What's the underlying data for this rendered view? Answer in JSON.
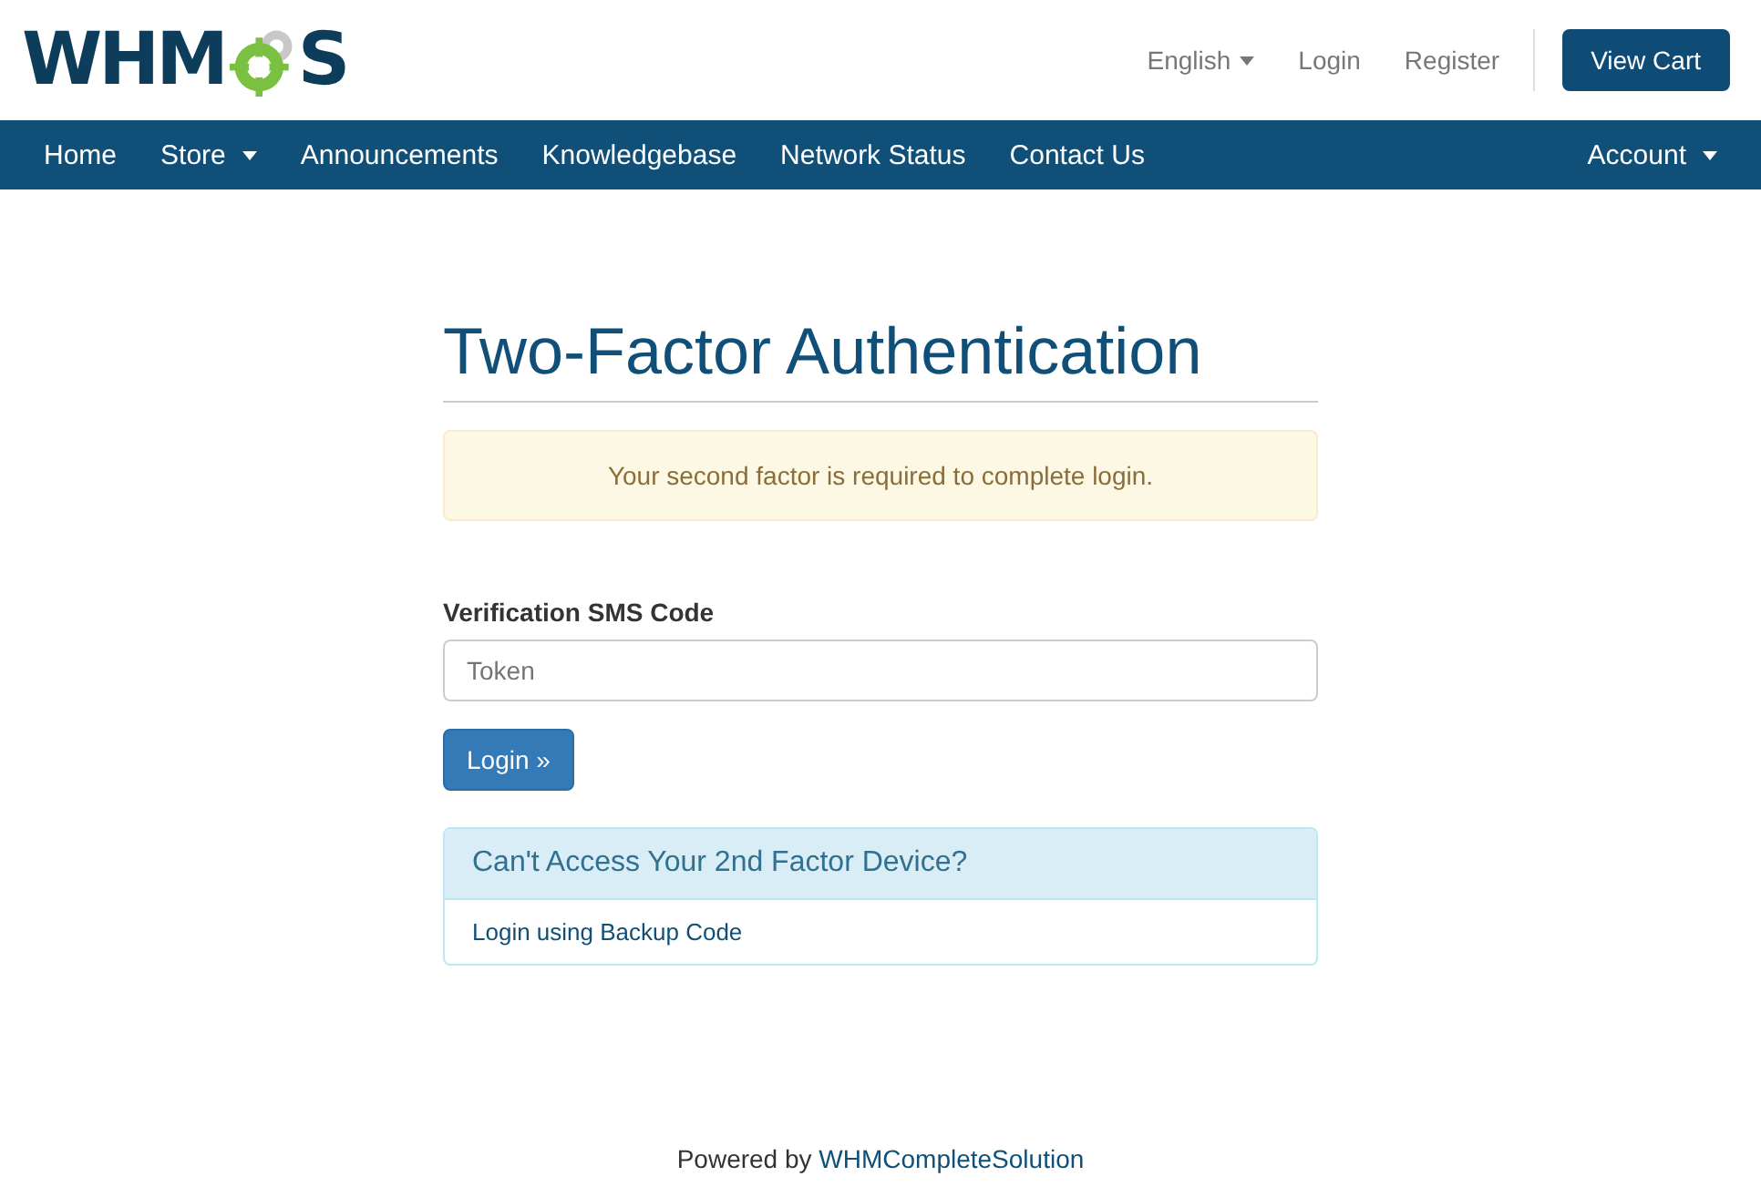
{
  "logo": {
    "text_before": "WHM",
    "text_after": "S"
  },
  "top_links": [
    {
      "label": "English",
      "dropdown": true
    },
    {
      "label": "Login",
      "dropdown": false
    },
    {
      "label": "Register",
      "dropdown": false
    }
  ],
  "cart_button": "View Cart",
  "nav": {
    "left": [
      {
        "label": "Home",
        "dropdown": false
      },
      {
        "label": "Store",
        "dropdown": true
      },
      {
        "label": "Announcements",
        "dropdown": false
      },
      {
        "label": "Knowledgebase",
        "dropdown": false
      },
      {
        "label": "Network Status",
        "dropdown": false
      },
      {
        "label": "Contact Us",
        "dropdown": false
      }
    ],
    "right": [
      {
        "label": "Account",
        "dropdown": true
      }
    ]
  },
  "title": "Two-Factor Authentication",
  "alert": "Your second factor is required to complete login.",
  "field": {
    "label": "Verification SMS Code",
    "placeholder": "Token"
  },
  "submit": "Login »",
  "panel": {
    "heading": "Can't Access Your 2nd Factor Device?",
    "link": "Login using Backup Code"
  },
  "footer": {
    "text": "Powered by",
    "link": "WHMCompleteSolution"
  }
}
